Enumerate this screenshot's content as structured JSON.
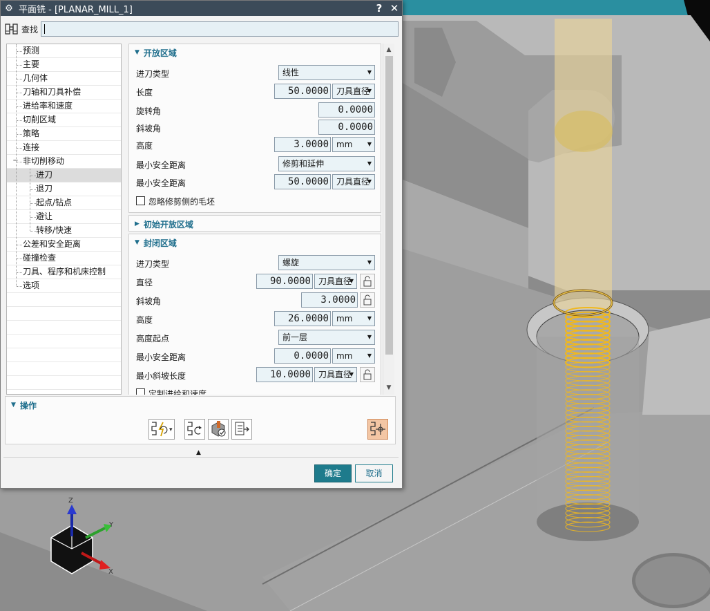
{
  "window": {
    "title": "平面铣 - [PLANAR_MILL_1]",
    "help_label": "?",
    "close_label": "✕"
  },
  "search": {
    "label": "查找",
    "value": ""
  },
  "tree": {
    "items": [
      {
        "label": "预测"
      },
      {
        "label": "主要"
      },
      {
        "label": "几何体"
      },
      {
        "label": "刀轴和刀具补偿"
      },
      {
        "label": "进给率和速度"
      },
      {
        "label": "切削区域"
      },
      {
        "label": "策略"
      },
      {
        "label": "连接"
      },
      {
        "label": "非切削移动",
        "expanded": true
      },
      {
        "label": "进刀",
        "selected": true
      },
      {
        "label": "退刀"
      },
      {
        "label": "起点/钻点"
      },
      {
        "label": "避让"
      },
      {
        "label": "转移/快速"
      },
      {
        "label": "公差和安全距离"
      },
      {
        "label": "碰撞检查"
      },
      {
        "label": "刀具、程序和机床控制"
      },
      {
        "label": "选项"
      }
    ]
  },
  "open_area": {
    "title": "开放区域",
    "engage_type_label": "进刀类型",
    "engage_type_value": "线性",
    "length_label": "长度",
    "length_value": "50.0000",
    "length_unit": "刀具直径",
    "rotation_label": "旋转角",
    "rotation_value": "0.0000",
    "ramp_label": "斜坡角",
    "ramp_value": "0.0000",
    "height_label": "高度",
    "height_value": "3.0000",
    "height_unit": "mm",
    "min_clear_label": "最小安全距离",
    "min_clear_type": "修剪和延伸",
    "min_clear2_label": "最小安全距离",
    "min_clear2_value": "50.0000",
    "min_clear2_unit": "刀具直径",
    "ignore_label": "忽略修剪侧的毛坯",
    "ignore_checked": false
  },
  "initial_open_area": {
    "title": "初始开放区域"
  },
  "closed_area": {
    "title": "封闭区域",
    "engage_type_label": "进刀类型",
    "engage_type_value": "螺旋",
    "diameter_label": "直径",
    "diameter_value": "90.0000",
    "diameter_unit": "刀具直径",
    "ramp_label": "斜坡角",
    "ramp_value": "3.0000",
    "height_label": "高度",
    "height_value": "26.0000",
    "height_unit": "mm",
    "height_from_label": "高度起点",
    "height_from_value": "前一层",
    "min_clear_label": "最小安全距离",
    "min_clear_value": "0.0000",
    "min_clear_unit": "mm",
    "min_ramp_label": "最小斜坡长度",
    "min_ramp_value": "10.0000",
    "min_ramp_unit": "刀具直径",
    "custom_feed_label": "定制进给和速度"
  },
  "ops": {
    "title": "操作"
  },
  "buttons": {
    "ok": "确定",
    "cancel": "取消"
  },
  "triad": {
    "x_label": "X",
    "y_label": "Y",
    "z_label": "Z"
  },
  "colors": {
    "titlebar": "#3c4b59",
    "section_title": "#1e6e8c",
    "ok_button": "#1e7b8c",
    "toolpath": "#f0b81e"
  }
}
